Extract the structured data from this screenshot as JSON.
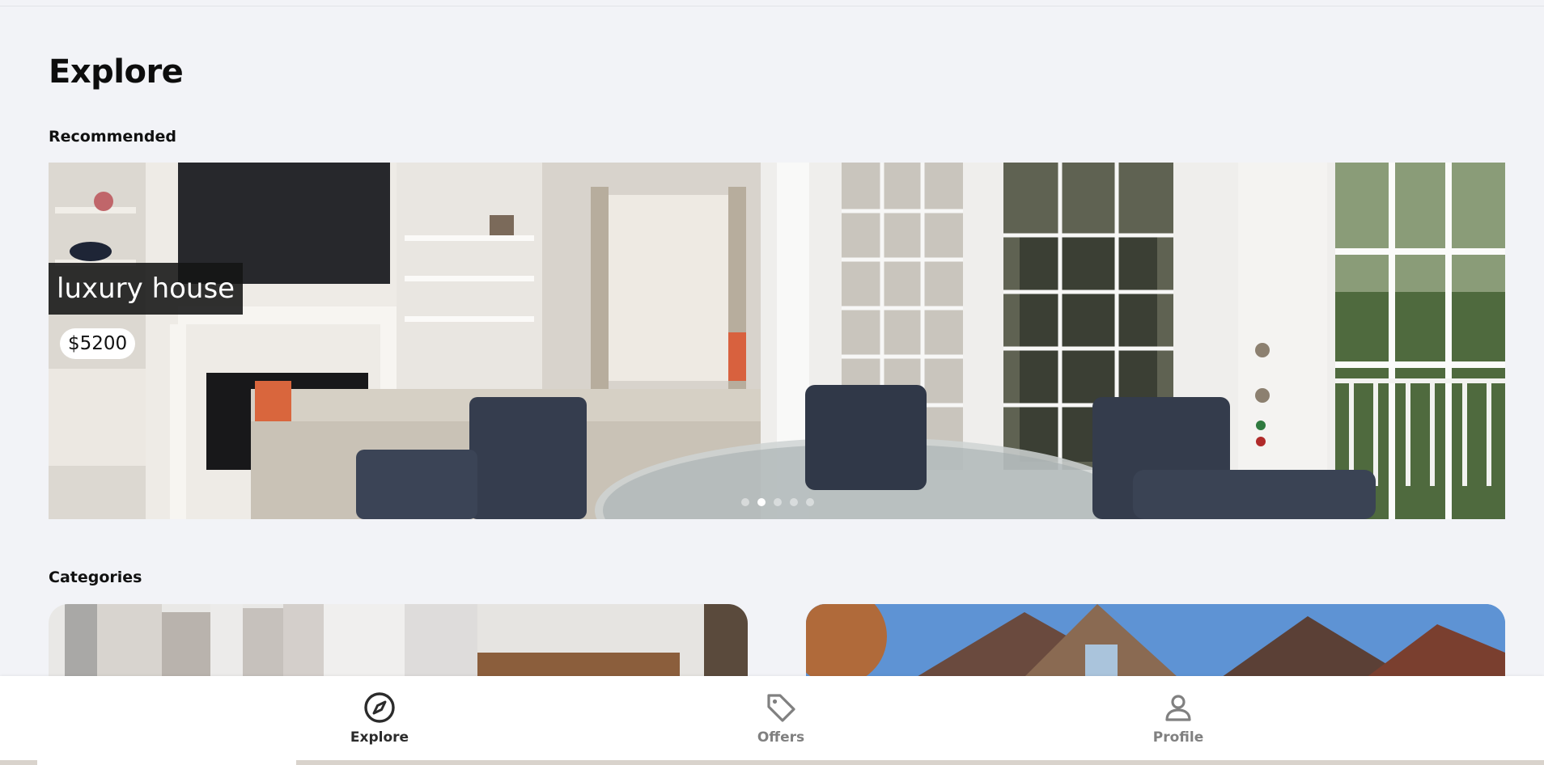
{
  "header": {
    "title": "Explore"
  },
  "sections": {
    "recommended": "Recommended",
    "categories": "Categories"
  },
  "carousel": {
    "listing_title": "luxury house",
    "listing_price": "$5200",
    "slide_count": 5,
    "active_slide": 2
  },
  "nav": {
    "items": [
      {
        "label": "Explore",
        "icon": "compass-icon",
        "active": true
      },
      {
        "label": "Offers",
        "icon": "tag-icon",
        "active": false
      },
      {
        "label": "Profile",
        "icon": "user-icon",
        "active": false
      }
    ]
  },
  "colors": {
    "background": "#f2f3f7",
    "nav_active": "#2b2b2b",
    "nav_inactive": "#808080",
    "title_overlay": "#141414"
  }
}
